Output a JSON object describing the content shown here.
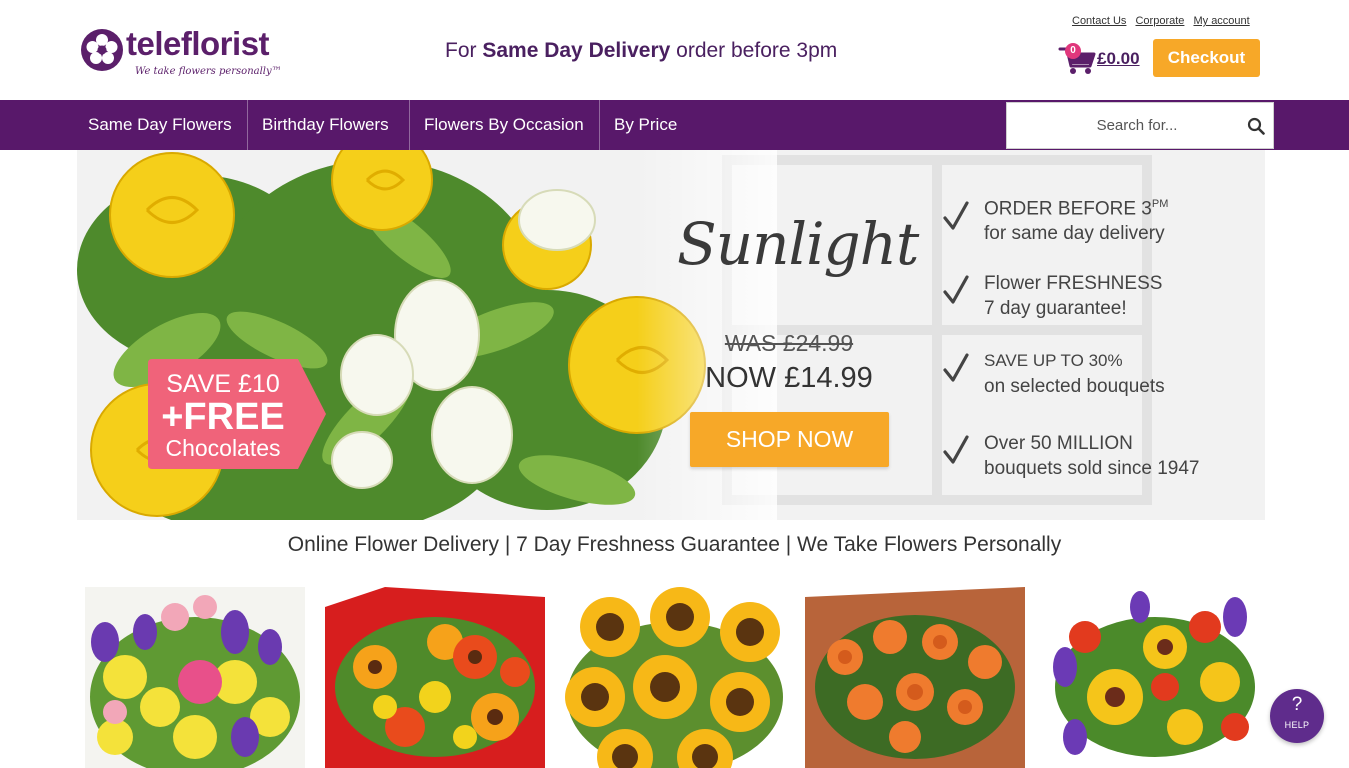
{
  "brand": {
    "name": "teleflorist",
    "tagline": "We take flowers personally™",
    "colors": {
      "primary": "#58186a",
      "accent": "#f7a828",
      "badge": "#e0377c",
      "sale": "#f0637a"
    }
  },
  "header": {
    "promo_prefix": "For ",
    "promo_strong": "Same Day Delivery",
    "promo_suffix": " order before 3pm",
    "top_links": [
      "Contact Us",
      "Corporate",
      "My account"
    ],
    "cart": {
      "count": "0",
      "total": "£0.00",
      "icon": "shopping-cart-icon"
    },
    "checkout_label": "Checkout"
  },
  "nav": {
    "items": [
      "Same Day Flowers",
      "Birthday Flowers",
      "Flowers By Occasion",
      "By Price"
    ],
    "search_placeholder": "Search for...",
    "search_icon": "magnifier-icon"
  },
  "hero": {
    "badge": {
      "line1": "SAVE £10",
      "line2": "+FREE",
      "line3": "Chocolates"
    },
    "product_title": "Sunlight",
    "was_price": "WAS £24.99",
    "now_price": "NOW £14.99",
    "cta_label": "SHOP NOW",
    "usps": [
      {
        "line1": "ORDER BEFORE 3",
        "line1_sup": "PM",
        "line2": "for same day delivery"
      },
      {
        "line1": "Flower FRESHNESS",
        "line2": "7 day guarantee!"
      },
      {
        "line1": "SAVE UP TO 30%",
        "line2": "on selected bouquets"
      },
      {
        "line1": "Over 50 MILLION",
        "line2": "bouquets sold since 1947"
      }
    ]
  },
  "tagline": "Online Flower Delivery | 7 Day Freshness Guarantee | We Take Flowers Personally",
  "products": [
    {
      "image": "mixed-pink-purple-yellow-bouquet"
    },
    {
      "image": "orange-red-gerbera-bouquet"
    },
    {
      "image": "sunflower-bouquet"
    },
    {
      "image": "orange-roses-bouquet"
    },
    {
      "image": "purple-yellow-red-mixed-bouquet"
    }
  ],
  "help": {
    "icon": "question-mark-icon",
    "label": "HELP"
  }
}
